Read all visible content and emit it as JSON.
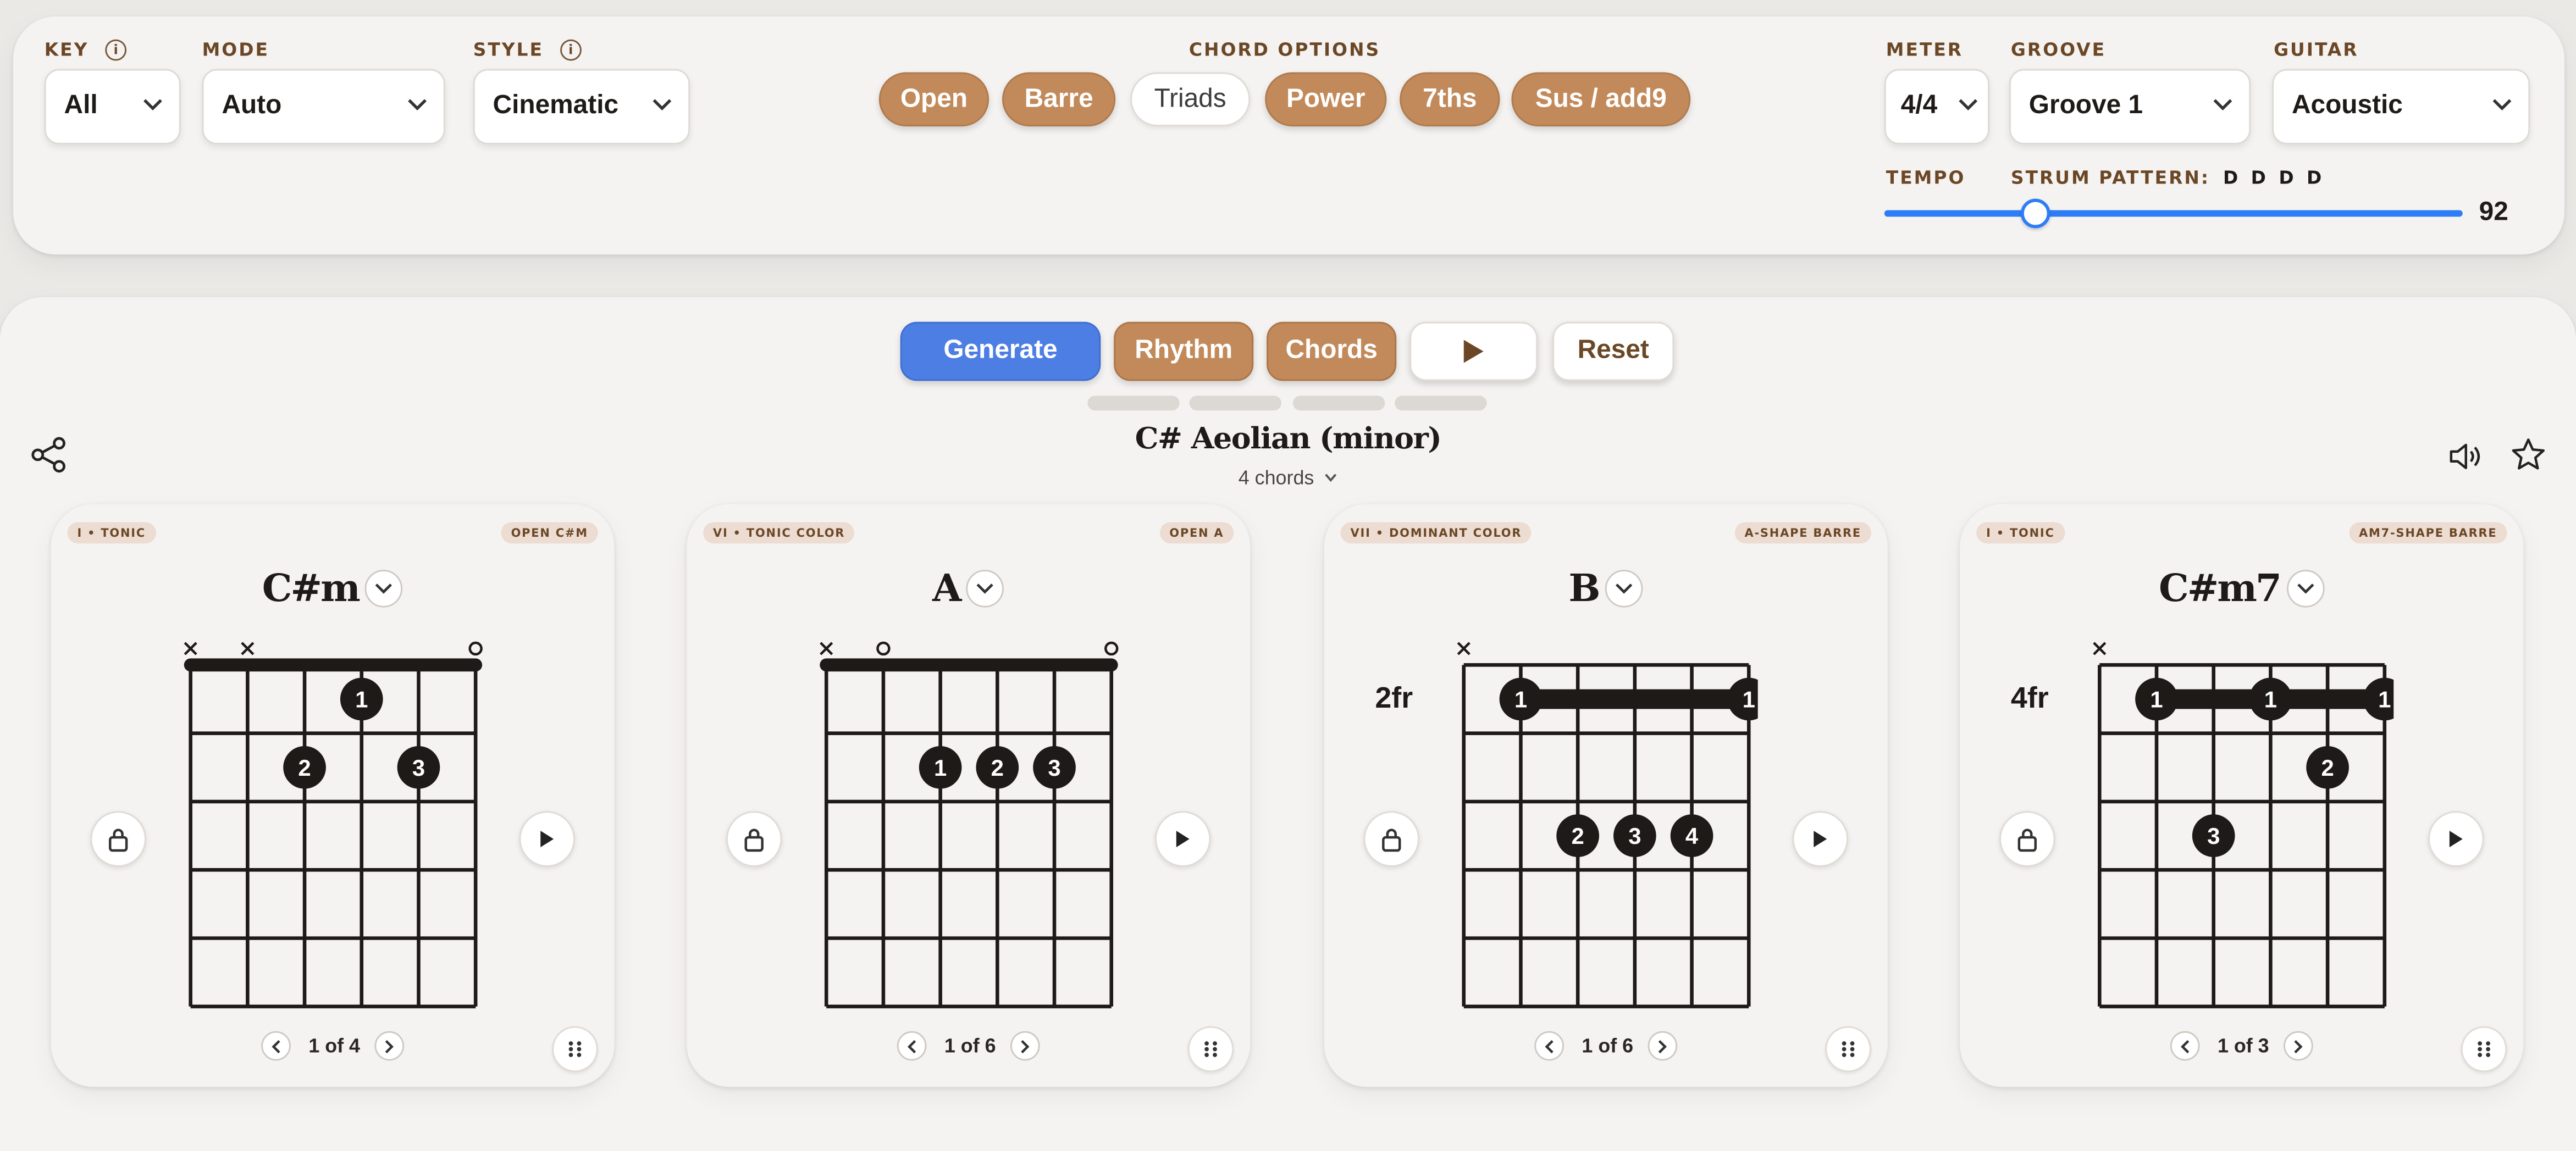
{
  "controls": {
    "key": {
      "label": "KEY",
      "value": "All"
    },
    "mode": {
      "label": "MODE",
      "value": "Auto"
    },
    "style": {
      "label": "STYLE",
      "value": "Cinematic"
    },
    "chord_options": {
      "label": "CHORD OPTIONS",
      "items": [
        {
          "label": "Open",
          "active": true
        },
        {
          "label": "Barre",
          "active": true
        },
        {
          "label": "Triads",
          "active": false
        },
        {
          "label": "Power",
          "active": true
        },
        {
          "label": "7ths",
          "active": true
        },
        {
          "label": "Sus / add9",
          "active": true
        }
      ]
    },
    "meter": {
      "label": "METER",
      "value": "4/4"
    },
    "groove": {
      "label": "GROOVE",
      "value": "Groove 1"
    },
    "guitar": {
      "label": "GUITAR",
      "value": "Acoustic"
    },
    "tempo": {
      "label": "TEMPO",
      "value": "92",
      "min": 40,
      "max": 240,
      "current": 92
    },
    "strum": {
      "label": "STRUM PATTERN:",
      "value": "D D D D"
    }
  },
  "actions": {
    "generate": "Generate",
    "rhythm": "Rhythm",
    "chords": "Chords",
    "reset": "Reset"
  },
  "progression": {
    "title": "C# Aeolian (minor)",
    "subtitle": "4 chords"
  },
  "icons": {
    "share": "share-icon",
    "volume": "volume-icon",
    "star": "star-icon"
  },
  "colors": {
    "accent": "#c28a5a",
    "primary": "#4d7ee3",
    "slider": "#2f7df6",
    "ink": "#1e1a17"
  },
  "chords": [
    {
      "role": "I • TONIC",
      "shape": "OPEN C#M",
      "name": "C#m",
      "pager": "1 of 4",
      "fret_label": "",
      "markers": [
        "x",
        "x",
        "",
        "",
        "",
        "o"
      ],
      "barre": null,
      "dots": [
        {
          "s": 4,
          "f": 1,
          "n": "1"
        },
        {
          "s": 3,
          "f": 2,
          "n": "2"
        },
        {
          "s": 5,
          "f": 2,
          "n": "3"
        }
      ]
    },
    {
      "role": "VI • TONIC COLOR",
      "shape": "OPEN A",
      "name": "A",
      "pager": "1 of 6",
      "fret_label": "",
      "markers": [
        "x",
        "o",
        "",
        "",
        "",
        "o"
      ],
      "barre": null,
      "dots": [
        {
          "s": 3,
          "f": 2,
          "n": "1"
        },
        {
          "s": 4,
          "f": 2,
          "n": "2"
        },
        {
          "s": 5,
          "f": 2,
          "n": "3"
        }
      ]
    },
    {
      "role": "VII • DOMINANT COLOR",
      "shape": "A-SHAPE BARRE",
      "name": "B",
      "pager": "1 of 6",
      "fret_label": "2fr",
      "markers": [
        "x",
        "",
        "",
        "",
        "",
        ""
      ],
      "barre": {
        "from": 2,
        "to": 6,
        "fret": 1,
        "n": "1"
      },
      "dots": [
        {
          "s": 3,
          "f": 3,
          "n": "2"
        },
        {
          "s": 4,
          "f": 3,
          "n": "3"
        },
        {
          "s": 5,
          "f": 3,
          "n": "4"
        }
      ]
    },
    {
      "role": "I • TONIC",
      "shape": "AM7-SHAPE BARRE",
      "name": "C#m7",
      "pager": "1 of 3",
      "fret_label": "4fr",
      "markers": [
        "x",
        "",
        "",
        "",
        "",
        ""
      ],
      "barre": {
        "from": 2,
        "to": 6,
        "fret": 1,
        "n": "1"
      },
      "dots": [
        {
          "s": 4,
          "f": 1,
          "n": "1"
        },
        {
          "s": 5,
          "f": 2,
          "n": "2"
        },
        {
          "s": 3,
          "f": 3,
          "n": "3"
        }
      ]
    }
  ]
}
